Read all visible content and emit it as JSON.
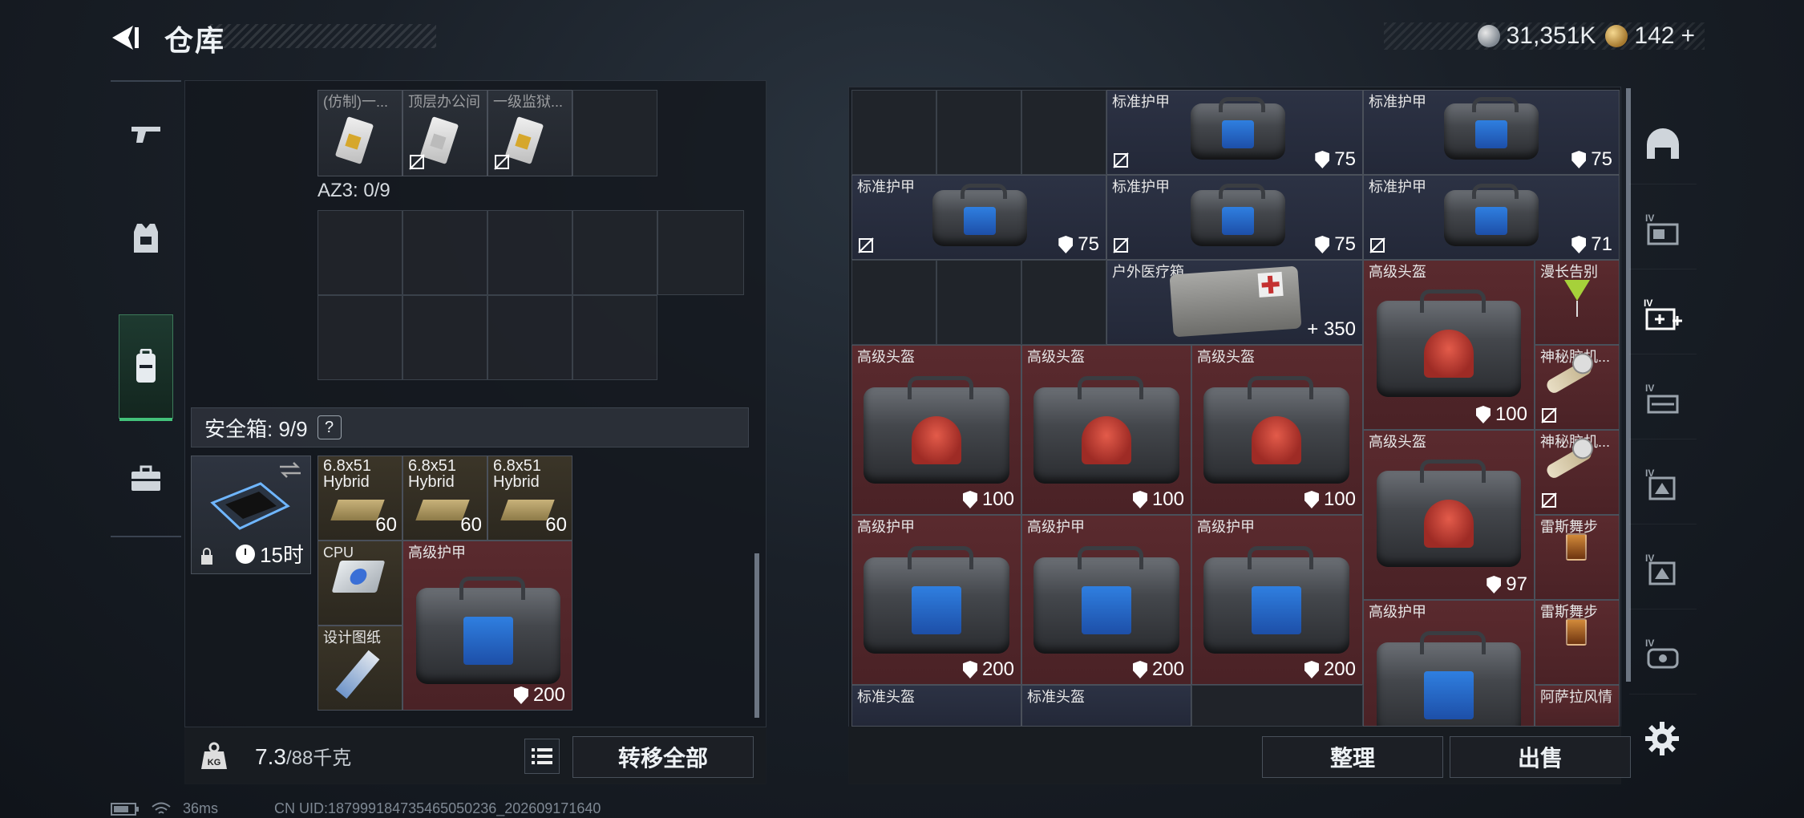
{
  "header": {
    "title": "仓库",
    "currency_silver": "31,351K",
    "currency_gold": "142",
    "currency_add": "+"
  },
  "left_nav": [
    "weapon-icon",
    "armor-icon",
    "backpack-icon",
    "briefcase-icon"
  ],
  "container_top": {
    "items": [
      {
        "label": "(仿制)一..."
      },
      {
        "label": "顶层办公间"
      },
      {
        "label": "一级监狱..."
      }
    ]
  },
  "az3": {
    "label": "AZ3: 0/9"
  },
  "safe_box": {
    "label": "安全箱: 9/9",
    "help": "?",
    "timer": "15时",
    "items": [
      {
        "name": "6.8x51\nHybrid",
        "count": "60"
      },
      {
        "name": "6.8x51\nHybrid",
        "count": "60"
      },
      {
        "name": "6.8x51\nHybrid",
        "count": "60"
      },
      {
        "name": "CPU"
      },
      {
        "name": "设计图纸"
      },
      {
        "name": "高级护甲",
        "value": "200"
      }
    ]
  },
  "bottom_left": {
    "weight": "7.3",
    "weight_max": "/88千克",
    "transfer_all": "转移全部"
  },
  "stash": {
    "items": [
      {
        "name": "标准护甲",
        "value": "75"
      },
      {
        "name": "标准护甲",
        "value": "75"
      },
      {
        "name": "标准护甲",
        "value": "75"
      },
      {
        "name": "标准护甲",
        "value": "75"
      },
      {
        "name": "标准护甲",
        "value": "71"
      },
      {
        "name": "户外医疗箱",
        "value": "+ 350"
      },
      {
        "name": "高级头盔",
        "value": "100"
      },
      {
        "name": "漫长告别"
      },
      {
        "name": "高级头盔",
        "value": "100"
      },
      {
        "name": "高级头盔",
        "value": "100"
      },
      {
        "name": "高级头盔",
        "value": "100"
      },
      {
        "name": "神秘脑机..."
      },
      {
        "name": "高级头盔",
        "value": "97"
      },
      {
        "name": "神秘脑机..."
      },
      {
        "name": "高级护甲",
        "value": "200"
      },
      {
        "name": "高级护甲",
        "value": "200"
      },
      {
        "name": "高级护甲",
        "value": "200"
      },
      {
        "name": "雷斯舞步"
      },
      {
        "name": "高级护甲"
      },
      {
        "name": "雷斯舞步"
      },
      {
        "name": "标准头盔"
      },
      {
        "name": "标准头盔"
      },
      {
        "name": "阿萨拉风情"
      }
    ],
    "sort_label": "整理",
    "sell_label": "出售"
  },
  "right_nav": [
    "helmet-icon",
    "container-iv-1-icon",
    "container-iv-add-icon",
    "container-iv-2-icon",
    "container-iv-3-icon",
    "container-iv-4-icon",
    "container-iv-5-icon"
  ],
  "status": {
    "ping": "36ms",
    "uid": "CN UID:18799918473546505​0236_202609171640"
  }
}
